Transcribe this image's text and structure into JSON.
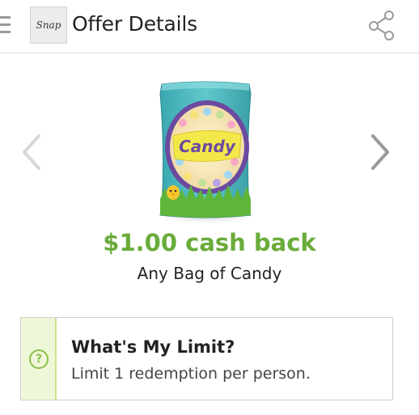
{
  "header": {
    "logo_text": "Snap",
    "title": "Offer Details",
    "menu_icon": "hamburger-icon",
    "share_icon": "share-icon"
  },
  "carousel": {
    "prev_icon": "chevron-left-icon",
    "next_icon": "chevron-right-icon",
    "product_label": "Candy"
  },
  "offer": {
    "cashback": "$1.00 cash back",
    "product": "Any Bag of Candy"
  },
  "limit": {
    "icon": "question-icon",
    "icon_glyph": "?",
    "title": "What's My Limit?",
    "text": "Limit 1 redemption per person."
  },
  "colors": {
    "accent_green": "#6aac3b",
    "strip_bg": "#eef7d8",
    "strip_border": "#c9e58d"
  }
}
